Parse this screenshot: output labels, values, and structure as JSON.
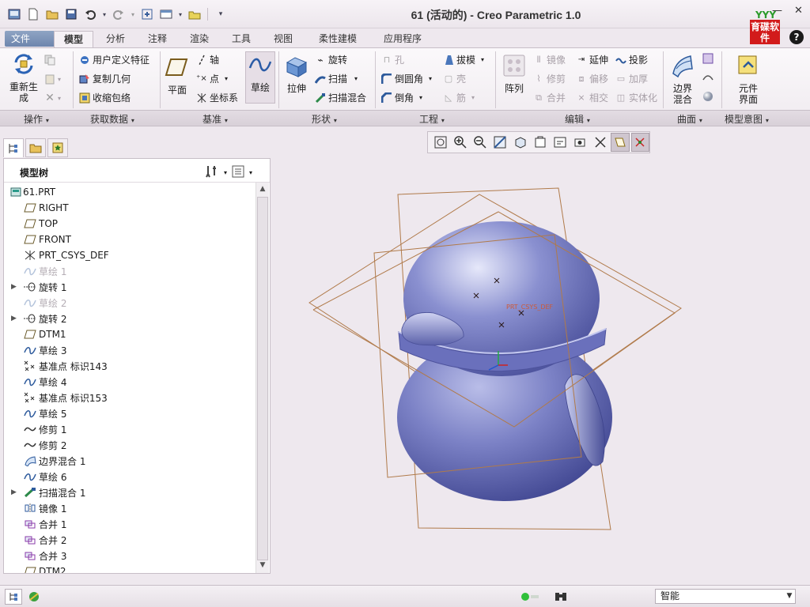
{
  "window": {
    "title": "61 (活动的) - Creo Parametric 1.0",
    "logo_top": "YYY",
    "logo_text": "育碟软件",
    "minimize": "—",
    "close": "✕",
    "help": "?"
  },
  "tabs": {
    "file": "文件",
    "items": [
      "模型",
      "分析",
      "注释",
      "渲染",
      "工具",
      "视图",
      "柔性建模",
      "应用程序"
    ]
  },
  "ribbon": {
    "regenerate": "重新生成",
    "user_feature": "用户定义特征",
    "copy_geometry": "复制几何",
    "shrinkwrap": "收缩包络",
    "plane": "平面",
    "axis": "轴",
    "point": "点",
    "csys": "坐标系",
    "sketch": "草绘",
    "extrude": "拉伸",
    "revolve": "旋转",
    "sweep": "扫描",
    "swept_blend": "扫描混合",
    "hole": "孔",
    "round": "倒圆角",
    "chamfer": "倒角",
    "draft": "拔模",
    "shell": "壳",
    "rib": "筋",
    "pattern": "阵列",
    "mirror": "镜像",
    "trim": "修剪",
    "merge": "合并",
    "extend": "延伸",
    "offset": "偏移",
    "intersect": "相交",
    "project": "投影",
    "thicken": "加厚",
    "solidify": "实体化",
    "boundary_blend": "边界混合",
    "component_interface": "元件界面",
    "groups": [
      "操作",
      "获取数据",
      "基准",
      "形状",
      "工程",
      "编辑",
      "曲面",
      "模型意图"
    ]
  },
  "panel": {
    "title": "模型树",
    "rows": [
      {
        "label": "61.PRT",
        "icon": "part-icon"
      },
      {
        "label": "RIGHT",
        "icon": "datum-plane-icon"
      },
      {
        "label": "TOP",
        "icon": "datum-plane-icon"
      },
      {
        "label": "FRONT",
        "icon": "datum-plane-icon"
      },
      {
        "label": "PRT_CSYS_DEF",
        "icon": "csys-icon"
      },
      {
        "label": "草绘 1",
        "icon": "sketch-icon",
        "state": "suppressed"
      },
      {
        "label": "旋转 1",
        "icon": "revolve-icon",
        "expand": true
      },
      {
        "label": "草绘 2",
        "icon": "sketch-icon",
        "state": "suppressed"
      },
      {
        "label": "旋转 2",
        "icon": "revolve-icon",
        "expand": true
      },
      {
        "label": "DTM1",
        "icon": "datum-plane-icon"
      },
      {
        "label": "草绘 3",
        "icon": "sketch-icon"
      },
      {
        "label": "基准点 标识143",
        "icon": "datum-point-icon"
      },
      {
        "label": "草绘 4",
        "icon": "sketch-icon"
      },
      {
        "label": "基准点 标识153",
        "icon": "datum-point-icon"
      },
      {
        "label": "草绘 5",
        "icon": "sketch-icon"
      },
      {
        "label": "修剪 1",
        "icon": "trim-icon"
      },
      {
        "label": "修剪 2",
        "icon": "trim-icon"
      },
      {
        "label": "边界混合 1",
        "icon": "boundary-blend-icon"
      },
      {
        "label": "草绘 6",
        "icon": "sketch-icon"
      },
      {
        "label": "扫描混合 1",
        "icon": "swept-blend-icon",
        "expand": true
      },
      {
        "label": "镜像 1",
        "icon": "mirror-icon"
      },
      {
        "label": "合并 1",
        "icon": "merge-icon"
      },
      {
        "label": "合并 2",
        "icon": "merge-icon"
      },
      {
        "label": "合并 3",
        "icon": "merge-icon"
      },
      {
        "label": "DTM2",
        "icon": "datum-plane-icon"
      }
    ]
  },
  "model": {
    "csys_label": "PRT_CSYS_DEF"
  },
  "status": {
    "filter": "智能"
  }
}
